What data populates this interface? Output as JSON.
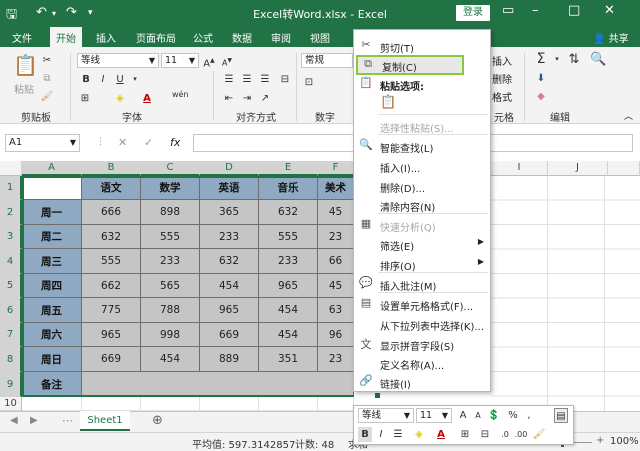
{
  "window": {
    "title": "Excel转Word.xlsx  -  Excel",
    "login": "登录",
    "share": "共享"
  },
  "tabs": [
    "文件",
    "开始",
    "插入",
    "页面布局",
    "公式",
    "数据",
    "审阅",
    "视图"
  ],
  "ribbon": {
    "paste_label": "粘贴",
    "font_name": "等线",
    "font_size": "11",
    "number_format": "常规",
    "groups": {
      "clipboard": "剪贴板",
      "font": "字体",
      "alignment": "对齐方式",
      "number": "数字",
      "cells_partial": "元格",
      "editing": "编辑"
    },
    "cells_insert": "插入",
    "cells_delete": "删除",
    "cells_format": "格式"
  },
  "formula_bar": {
    "name_box": "A1"
  },
  "columns": [
    "A",
    "B",
    "C",
    "D",
    "E",
    "F",
    "I",
    "J"
  ],
  "rows": [
    "1",
    "2",
    "3",
    "4",
    "5",
    "6",
    "7",
    "8",
    "9",
    "10"
  ],
  "table": {
    "headers": [
      "语文",
      "数学",
      "英语",
      "音乐",
      "美术"
    ],
    "rows": [
      {
        "day": "周一",
        "vals": [
          "666",
          "898",
          "365",
          "632",
          "45"
        ]
      },
      {
        "day": "周二",
        "vals": [
          "632",
          "555",
          "233",
          "555",
          "23"
        ]
      },
      {
        "day": "周三",
        "vals": [
          "555",
          "233",
          "632",
          "233",
          "66"
        ]
      },
      {
        "day": "周四",
        "vals": [
          "662",
          "565",
          "454",
          "965",
          "45"
        ]
      },
      {
        "day": "周五",
        "vals": [
          "775",
          "788",
          "965",
          "454",
          "63"
        ]
      },
      {
        "day": "周六",
        "vals": [
          "965",
          "998",
          "669",
          "454",
          "96"
        ]
      },
      {
        "day": "周日",
        "vals": [
          "669",
          "454",
          "889",
          "351",
          "23"
        ]
      }
    ],
    "note": "备注"
  },
  "sheet": {
    "tab": "Sheet1"
  },
  "status": {
    "average": "平均值: 597.3142857",
    "count": "计数: 48",
    "sum": "求和",
    "zoom": "100%"
  },
  "context_menu": {
    "items": [
      {
        "label": "剪切(T)",
        "icon": "scissors-icon",
        "disabled": false
      },
      {
        "label": "复制(C)",
        "icon": "copy-icon",
        "disabled": false
      },
      {
        "label": "粘贴选项:",
        "icon": "paste-icon",
        "disabled": false,
        "header": true
      },
      {
        "label": "",
        "icon": "paste-clipboard-icon",
        "disabled": true
      },
      {
        "label": "选择性粘贴(S)...",
        "icon": "",
        "disabled": true
      },
      {
        "label": "智能查找(L)",
        "icon": "smart-lookup-icon",
        "disabled": false
      },
      {
        "label": "插入(I)...",
        "icon": "",
        "disabled": false
      },
      {
        "label": "删除(D)...",
        "icon": "",
        "disabled": false
      },
      {
        "label": "清除内容(N)",
        "icon": "",
        "disabled": false
      },
      {
        "label": "快速分析(Q)",
        "icon": "quick-analysis-icon",
        "disabled": true
      },
      {
        "label": "筛选(E)",
        "icon": "",
        "disabled": false,
        "submenu": true
      },
      {
        "label": "排序(O)",
        "icon": "",
        "disabled": false,
        "submenu": true
      },
      {
        "label": "插入批注(M)",
        "icon": "comment-icon",
        "disabled": false
      },
      {
        "label": "设置单元格格式(F)...",
        "icon": "format-cells-icon",
        "disabled": false
      },
      {
        "label": "从下拉列表中选择(K)...",
        "icon": "",
        "disabled": false
      },
      {
        "label": "显示拼音字段(S)",
        "icon": "phonetic-icon",
        "disabled": false
      },
      {
        "label": "定义名称(A)...",
        "icon": "",
        "disabled": false
      },
      {
        "label": "链接(I)",
        "icon": "link-icon",
        "disabled": false
      }
    ]
  },
  "mini_toolbar": {
    "font_name": "等线",
    "font_size": "11"
  },
  "colors": {
    "accent": "#217346",
    "header_fill": "#8ea9c1",
    "data_fill": "#c5c5c5"
  }
}
